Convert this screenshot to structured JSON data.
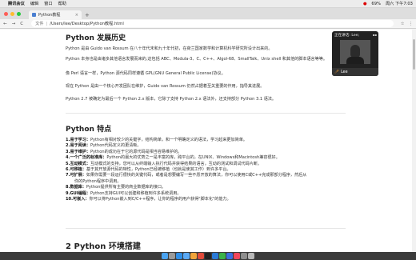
{
  "menubar": {
    "app": "腾讯会议",
    "items": [
      "编辑",
      "窗口",
      "帮助"
    ],
    "battery": "69%",
    "clock": "周六 下午7:03",
    "recording": "●"
  },
  "browser": {
    "tab_title": "Python教程",
    "tab_close": "×",
    "new_tab": "+",
    "nav_back": "←",
    "nav_forward": "→",
    "nav_reload": "C",
    "security_label": "文件",
    "url": "/Users/lee/Desktop/Python教程.html",
    "star": "☆",
    "menu": "⋮"
  },
  "article": {
    "history_title": "Python 发展历史",
    "history_p1": "Python 是由 Guido van Rossum 在八十年代末和九十年代初，在荷兰国家数学和计算机科学研究所设计出来的。",
    "history_p2": "Python 本身也是由诸多其他语言发展而来的,这包括 ABC、Modula-3、C、C++、Algol-68、SmallTalk、Unix shell 和其他的脚本语言等等。",
    "history_p3": "像 Perl 语言一样，Python 源代码同样遵循 GPL(GNU General Public License)协议。",
    "history_p4": "现在 Python 是由一个核心开发团队在维护，Guido van Rossum 仍然占据着至关重要的作用，指导其进展。",
    "history_p5": "Python 2.7 被确定为最后一个 Python 2.x 版本，它除了支持 Python 2.x 语法外，还支持部分 Python 3.1 语法。",
    "features_title": "Python 特点",
    "features": [
      {
        "label": "1.易于学习：",
        "text": "Python有相对较少的关键字，结构简单，和一个明确定义的语法，学习起来更加简单。"
      },
      {
        "label": "2.易于阅读：",
        "text": "Python代码定义的更清晰。"
      },
      {
        "label": "3.易于维护：",
        "text": "Python的成功在于它的源代码是相当容易维护的。"
      },
      {
        "label": "4.一个广泛的标准库：",
        "text": "Python的最大的优势之一是丰富的库，跨平台的，在UNIX、Windows和Macintosh兼容很好。"
      },
      {
        "label": "5.互动模式：",
        "text": "互动模式的支持，您可以从终端输入执行代码并获得结果的语言，互动的测试和调试代码片断。"
      },
      {
        "label": "6.可移植：",
        "text": "基于其开放源代码的特性，Python已经被移植（也就是使其工作）到许多平台。"
      },
      {
        "label": "7.可扩展：",
        "text": "如果你需要一段运行很快的关键代码，或者是想要编写一些不愿开放的算法，你可以使用C或C++完成那部分程序，然后从"
      },
      {
        "label": "",
        "text": "你的Python程序中调用。"
      },
      {
        "label": "8.数据库：",
        "text": "Python提供所有主要的商业数据库的接口。"
      },
      {
        "label": "9.GUI编程：",
        "text": "Python支持GUI可以创建和移植到许多系统调用。"
      },
      {
        "label": "10.可嵌入：",
        "text": "你可以将Python嵌入到C/C++程序，让你的程序的用户获得\"脚本化\"的能力。"
      }
    ],
    "env_title": "2 Python 环境搭建"
  },
  "call": {
    "speaker_label": "正在讲话: Lee;",
    "participant_name": "Lee",
    "mic_icon": "mic-muted-icon"
  },
  "colors": {
    "close": "#fd5e57",
    "minimize": "#febc2e",
    "maximize": "#28c840",
    "accent": "#4a7fd1"
  },
  "dock": {
    "icons": [
      "finder-icon",
      "launchpad-icon",
      "safari-icon",
      "mail-icon",
      "photos-icon",
      "chrome-icon",
      "terminal-icon",
      "vscode-icon",
      "wechat-icon",
      "meeting-icon",
      "music-icon",
      "settings-icon",
      "trash-icon"
    ]
  }
}
